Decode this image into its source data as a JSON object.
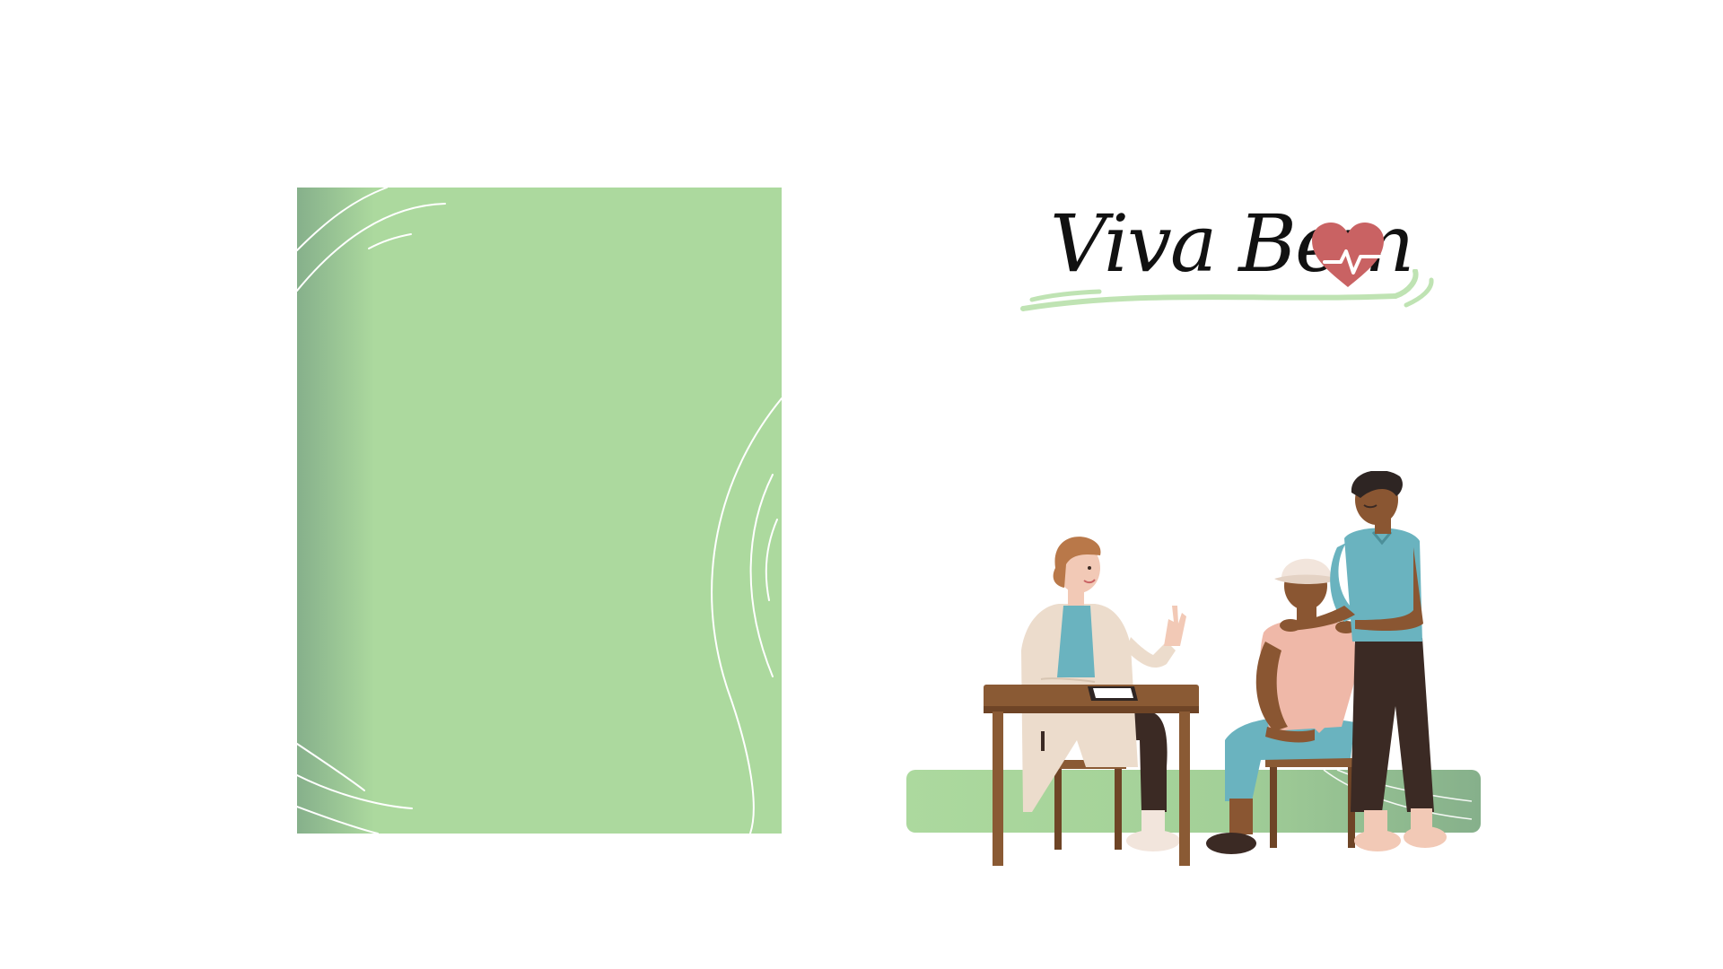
{
  "brand": {
    "title": "Viva Bem"
  },
  "colors": {
    "panel": "#acd99e",
    "panel_shadow": "#86b08b",
    "swoosh": "#bfe3b3",
    "heart": "#c96263",
    "ground": "#acd99e",
    "wood": "#8a5a34",
    "coat": "#ecdccc",
    "teal": "#6ab3bf",
    "skin_light": "#f2c9b6",
    "skin_dark": "#8a5632",
    "pants_dark": "#3b2a24",
    "top_pink": "#efb8a8"
  },
  "icons": {
    "logo_heart": "heart-pulse-icon"
  }
}
